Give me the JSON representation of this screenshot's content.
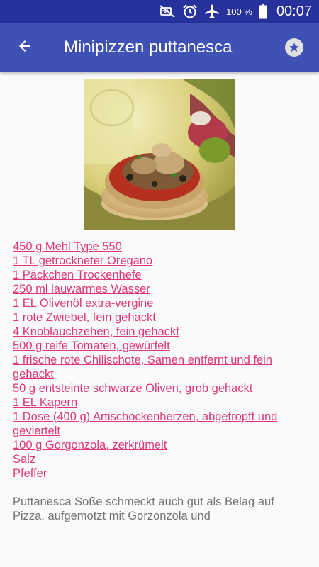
{
  "status_bar": {
    "battery_percent": "100 %",
    "time": "00:07",
    "icons": [
      "mute-icon",
      "alarm-icon",
      "airplane-mode-icon",
      "battery-icon"
    ]
  },
  "app_bar": {
    "title": "Minipizzen puttanesca",
    "back_icon": "arrow-left-icon",
    "favorite_icon": "star-icon"
  },
  "recipe": {
    "image": "photo of minipizza with artichokes and olives",
    "ingredients": [
      "450 g Mehl Type 550",
      "1 TL getrockneter Oregano",
      "1 Päckchen Trockenhefe",
      "250 ml lauwarmes Wasser",
      "1 EL Olivenöl extra-vergine",
      "1 rote Zwiebel, fein gehackt",
      "4 Knoblauchzehen, fein gehackt",
      "500 g reife Tomaten, gewürfelt",
      "1 frische rote Chilischote, Samen entfernt und fein gehackt",
      "50 g entsteinte schwarze Oliven, grob gehackt",
      "1 EL Kapern",
      "1 Dose (400 g) Artischockenherzen, abgetropft und geviertelt",
      "100 g Gorgonzola, zerkrümelt",
      "Salz",
      "Pfeffer"
    ],
    "note": "Puttanesca Soße schmeckt auch gut als Belag auf Pizza, aufgemotzt mit Gorzonzola und"
  },
  "colors": {
    "app_bar": "#3f51b5",
    "status_bar": "#27319b",
    "ingredient_link": "#e0387a",
    "note_text": "#737373",
    "background": "#fafafa"
  }
}
